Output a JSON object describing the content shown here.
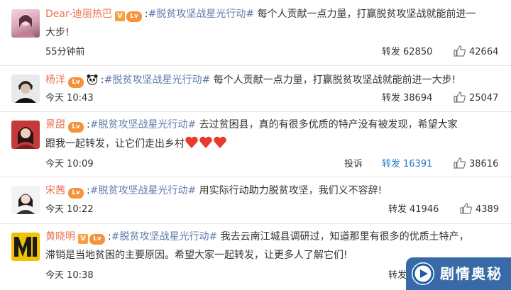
{
  "actions": {
    "repost": "转发",
    "report": "投诉"
  },
  "posts": [
    {
      "username": "Dear-迪丽热巴",
      "level": "Lv",
      "topic": "#脱贫攻坚战星光行动#",
      "text_line1": " 每个人贡献一点力量，打赢脱贫攻坚战就能前进一",
      "text_line2": "大步!",
      "time": "55分钟前",
      "reposts": "62850",
      "likes": "42664"
    },
    {
      "username": "杨洋",
      "level": "Lv",
      "topic": "#脱贫攻坚战星光行动#",
      "text_line1": " 每个人贡献一点力量，打赢脱贫攻坚战就能前进一大步!",
      "time": "今天 10:43",
      "reposts": "38694",
      "likes": "25047"
    },
    {
      "username": "景甜",
      "level": "Lv",
      "topic": "#脱贫攻坚战星光行动#",
      "text_line1": " 去过贫困县，真的有很多优质的特产没有被发现，希望大家",
      "text_line2": "跟我一起转发，让它们走出乡村",
      "time": "今天 10:09",
      "reposts": "16391",
      "likes": "38616"
    },
    {
      "username": "宋茜",
      "level": "Lv",
      "topic": "#脱贫攻坚战星光行动#",
      "text_line1": " 用实际行动助力脱贫攻坚，我们义不容辞!",
      "time": "今天 10:22",
      "reposts": "41946",
      "likes": "4389"
    },
    {
      "username": "黄晓明",
      "level": "Lv",
      "topic": "#脱贫攻坚战星光行动#",
      "text_line1": " 我去云南江城县调研过，知道那里有很多的优质土特产，",
      "text_line2": "滞销是当地贫困的主要原因。希望大家一起转发，让更多人了解它们!",
      "time": "今天 10:38",
      "reposts": ""
    }
  ],
  "watermark": {
    "text": "剧情奥秘"
  },
  "colors": {
    "username": "#eb7350",
    "topic": "#5d7ba8",
    "highlight": "#1e78c8"
  },
  "icons": [
    "verified-v-icon",
    "level-badge-icon",
    "panda-emoji-icon",
    "heart-emoji-icon",
    "thumb-up-icon"
  ]
}
